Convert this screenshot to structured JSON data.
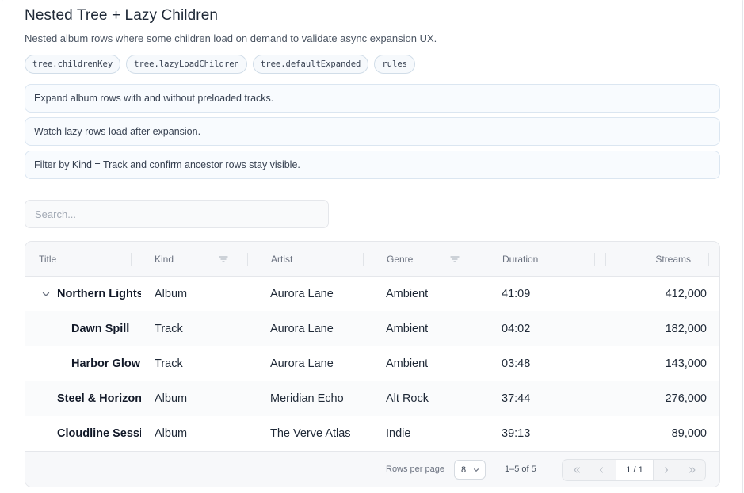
{
  "header": {
    "title": "Nested Tree + Lazy Children",
    "subtitle": "Nested album rows where some children load on demand to validate async expansion UX."
  },
  "chips": [
    "tree.childrenKey",
    "tree.lazyLoadChildren",
    "tree.defaultExpanded",
    "rules"
  ],
  "notes": [
    "Expand album rows with and without preloaded tracks.",
    "Watch lazy rows load after expansion.",
    "Filter by Kind = Track and confirm ancestor rows stay visible."
  ],
  "search": {
    "placeholder": "Search...",
    "value": ""
  },
  "table": {
    "columns": [
      "Title",
      "Kind",
      "Artist",
      "Genre",
      "Duration",
      "Streams"
    ],
    "filterable_columns": [
      "Kind",
      "Genre"
    ],
    "rows": [
      {
        "title": "Northern Lights",
        "kind": "Album",
        "artist": "Aurora Lane",
        "genre": "Ambient",
        "duration": "41:09",
        "streams": "412,000",
        "level": 0,
        "expanded": true
      },
      {
        "title": "Dawn Spill",
        "kind": "Track",
        "artist": "Aurora Lane",
        "genre": "Ambient",
        "duration": "04:02",
        "streams": "182,000",
        "level": 1
      },
      {
        "title": "Harbor Glow",
        "kind": "Track",
        "artist": "Aurora Lane",
        "genre": "Ambient",
        "duration": "03:48",
        "streams": "143,000",
        "level": 1
      },
      {
        "title": "Steel & Horizon",
        "kind": "Album",
        "artist": "Meridian Echo",
        "genre": "Alt Rock",
        "duration": "37:44",
        "streams": "276,000",
        "level": 0
      },
      {
        "title": "Cloudline Sessions",
        "kind": "Album",
        "artist": "The Verve Atlas",
        "genre": "Indie",
        "duration": "39:13",
        "streams": "89,000",
        "level": 0
      }
    ]
  },
  "footer": {
    "rows_per_page_label": "Rows per page",
    "rows_per_page_value": "8",
    "range_text": "1–5 of 5",
    "page_indicator": "1 / 1"
  },
  "icons": {
    "expander": "chevron-down-icon",
    "filter": "filter-icon",
    "first_page": "chevrons-left-icon",
    "prev_page": "chevron-left-icon",
    "next_page": "chevron-right-icon",
    "last_page": "chevrons-right-icon"
  },
  "colors": {
    "chip_border": "#d1dde8",
    "note_bg": "#f8fbfe",
    "header_bg": "#f7f8fa"
  }
}
